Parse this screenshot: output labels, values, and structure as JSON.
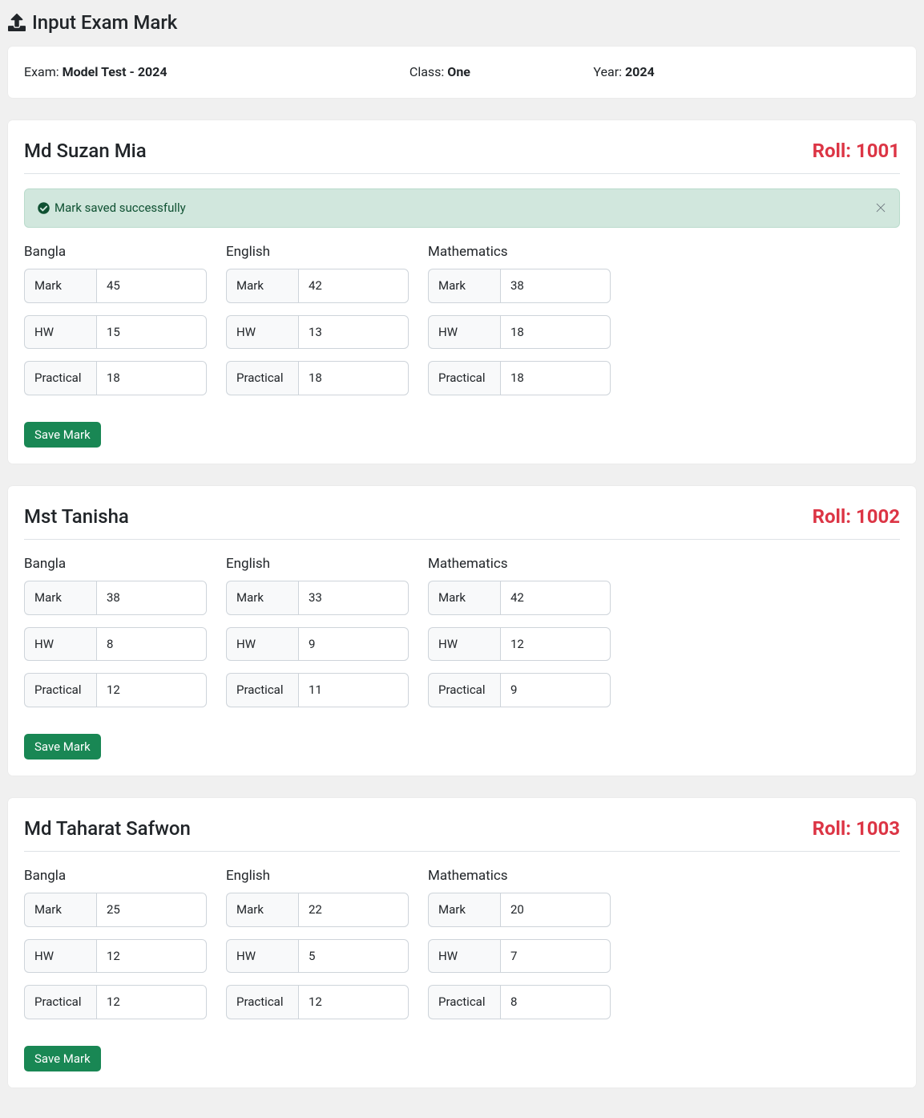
{
  "page_title": "Input Exam Mark",
  "info": {
    "exam_label": "Exam: ",
    "exam_value": "Model Test - 2024",
    "class_label": "Class: ",
    "class_value": "One",
    "year_label": "Year: ",
    "year_value": "2024"
  },
  "roll_prefix": "Roll: ",
  "subject_field_labels": {
    "mark": "Mark",
    "hw": "HW",
    "practical": "Practical"
  },
  "save_button_label": "Save Mark",
  "alert_success_msg": "Mark saved successfully",
  "students": [
    {
      "name": "Md Suzan Mia",
      "roll": "1001",
      "show_success": true,
      "subjects": [
        {
          "name": "Bangla",
          "mark": "45",
          "hw": "15",
          "practical": "18"
        },
        {
          "name": "English",
          "mark": "42",
          "hw": "13",
          "practical": "18"
        },
        {
          "name": "Mathematics",
          "mark": "38",
          "hw": "18",
          "practical": "18"
        }
      ]
    },
    {
      "name": "Mst Tanisha",
      "roll": "1002",
      "show_success": false,
      "subjects": [
        {
          "name": "Bangla",
          "mark": "38",
          "hw": "8",
          "practical": "12"
        },
        {
          "name": "English",
          "mark": "33",
          "hw": "9",
          "practical": "11"
        },
        {
          "name": "Mathematics",
          "mark": "42",
          "hw": "12",
          "practical": "9"
        }
      ]
    },
    {
      "name": "Md Taharat Safwon",
      "roll": "1003",
      "show_success": false,
      "subjects": [
        {
          "name": "Bangla",
          "mark": "25",
          "hw": "12",
          "practical": "12"
        },
        {
          "name": "English",
          "mark": "22",
          "hw": "5",
          "practical": "12"
        },
        {
          "name": "Mathematics",
          "mark": "20",
          "hw": "7",
          "practical": "8"
        }
      ]
    }
  ]
}
